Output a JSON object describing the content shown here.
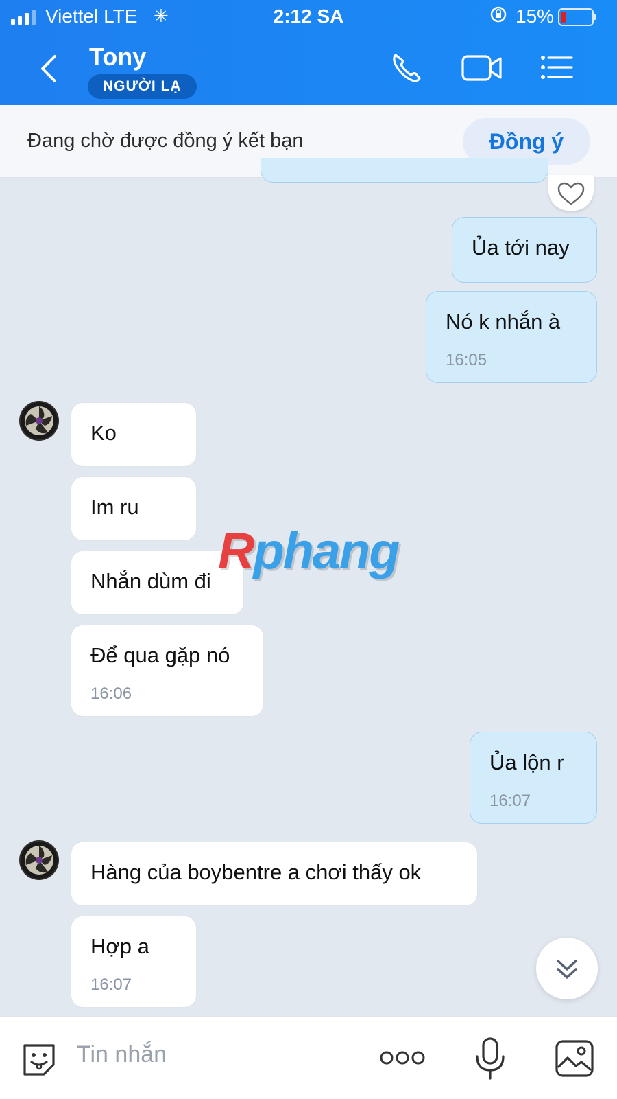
{
  "status_bar": {
    "carrier": "Viettel  LTE",
    "time": "2:12 SA",
    "battery": "15%"
  },
  "header": {
    "name": "Tony",
    "badge": "NGƯỜI LẠ"
  },
  "friend_request": {
    "text": "Đang chờ được đồng ý kết bạn",
    "accept_label": "Đồng ý"
  },
  "messages": [
    {
      "side": "out",
      "text": "Ủa tới nay",
      "time": ""
    },
    {
      "side": "out",
      "text": "Nó k nhắn à",
      "time": "16:05"
    },
    {
      "side": "in",
      "text": "Ko",
      "time": ""
    },
    {
      "side": "in",
      "text": "Im ru",
      "time": ""
    },
    {
      "side": "in",
      "text": "Nhắn dùm đi",
      "time": ""
    },
    {
      "side": "in",
      "text": "Để qua gặp nó",
      "time": "16:06"
    },
    {
      "side": "out",
      "text": "Ủa lộn r",
      "time": "16:07"
    },
    {
      "side": "in",
      "text": "Hàng của boybentre a chơi thấy ok",
      "time": ""
    },
    {
      "side": "in",
      "text": "Hợp a",
      "time": "16:07"
    }
  ],
  "watermark": {
    "part1": "R",
    "part2": "phang"
  },
  "composer": {
    "placeholder": "Tin nhắn"
  },
  "colors": {
    "header": "#1e7ff0",
    "outgoing_bubble": "#d3ecfb",
    "incoming_bubble": "#ffffff",
    "chat_background": "#e2e8f0"
  },
  "icons": [
    "back-icon",
    "phone-icon",
    "video-call-icon",
    "menu-icon",
    "heart-icon",
    "scroll-down-icon",
    "sticker-icon",
    "more-icon",
    "microphone-icon",
    "image-icon"
  ]
}
